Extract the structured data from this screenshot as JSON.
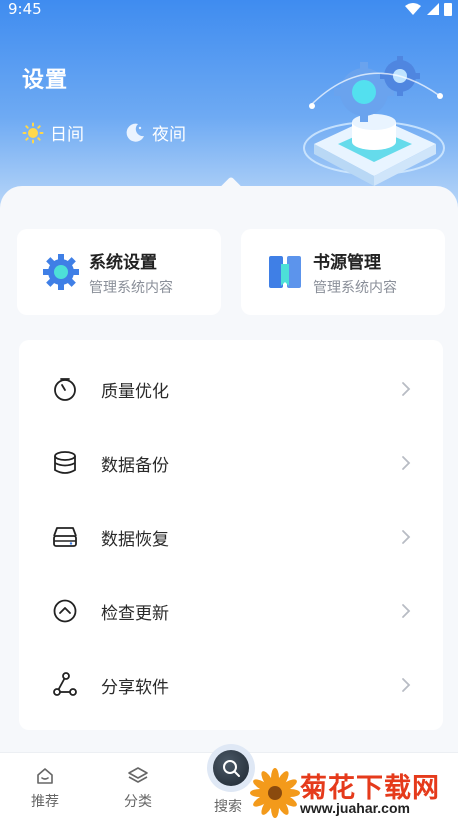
{
  "status": {
    "time": "9:45"
  },
  "header": {
    "title": "设置",
    "modes": [
      {
        "label": "日间",
        "icon": "sun-icon"
      },
      {
        "label": "夜间",
        "icon": "moon-icon"
      }
    ]
  },
  "cards": [
    {
      "title": "系统设置",
      "subtitle": "管理系统内容",
      "icon": "gear-icon"
    },
    {
      "title": "书源管理",
      "subtitle": "管理系统内容",
      "icon": "book-icon"
    }
  ],
  "menu": [
    {
      "label": "质量优化",
      "icon": "timer-icon"
    },
    {
      "label": "数据备份",
      "icon": "database-icon"
    },
    {
      "label": "数据恢复",
      "icon": "server-icon"
    },
    {
      "label": "检查更新",
      "icon": "upgrade-icon"
    },
    {
      "label": "分享软件",
      "icon": "share-icon"
    }
  ],
  "tabbar": {
    "items": [
      {
        "label": "推荐",
        "icon": "home-icon"
      },
      {
        "label": "分类",
        "icon": "layers-icon"
      },
      {
        "label": "搜索",
        "icon": "search-icon"
      }
    ]
  },
  "watermark": {
    "title": "菊花下载网",
    "url": "www.juahar.com"
  },
  "colors": {
    "accent": "#3f8cf0",
    "watermark": "#e53a1b"
  }
}
